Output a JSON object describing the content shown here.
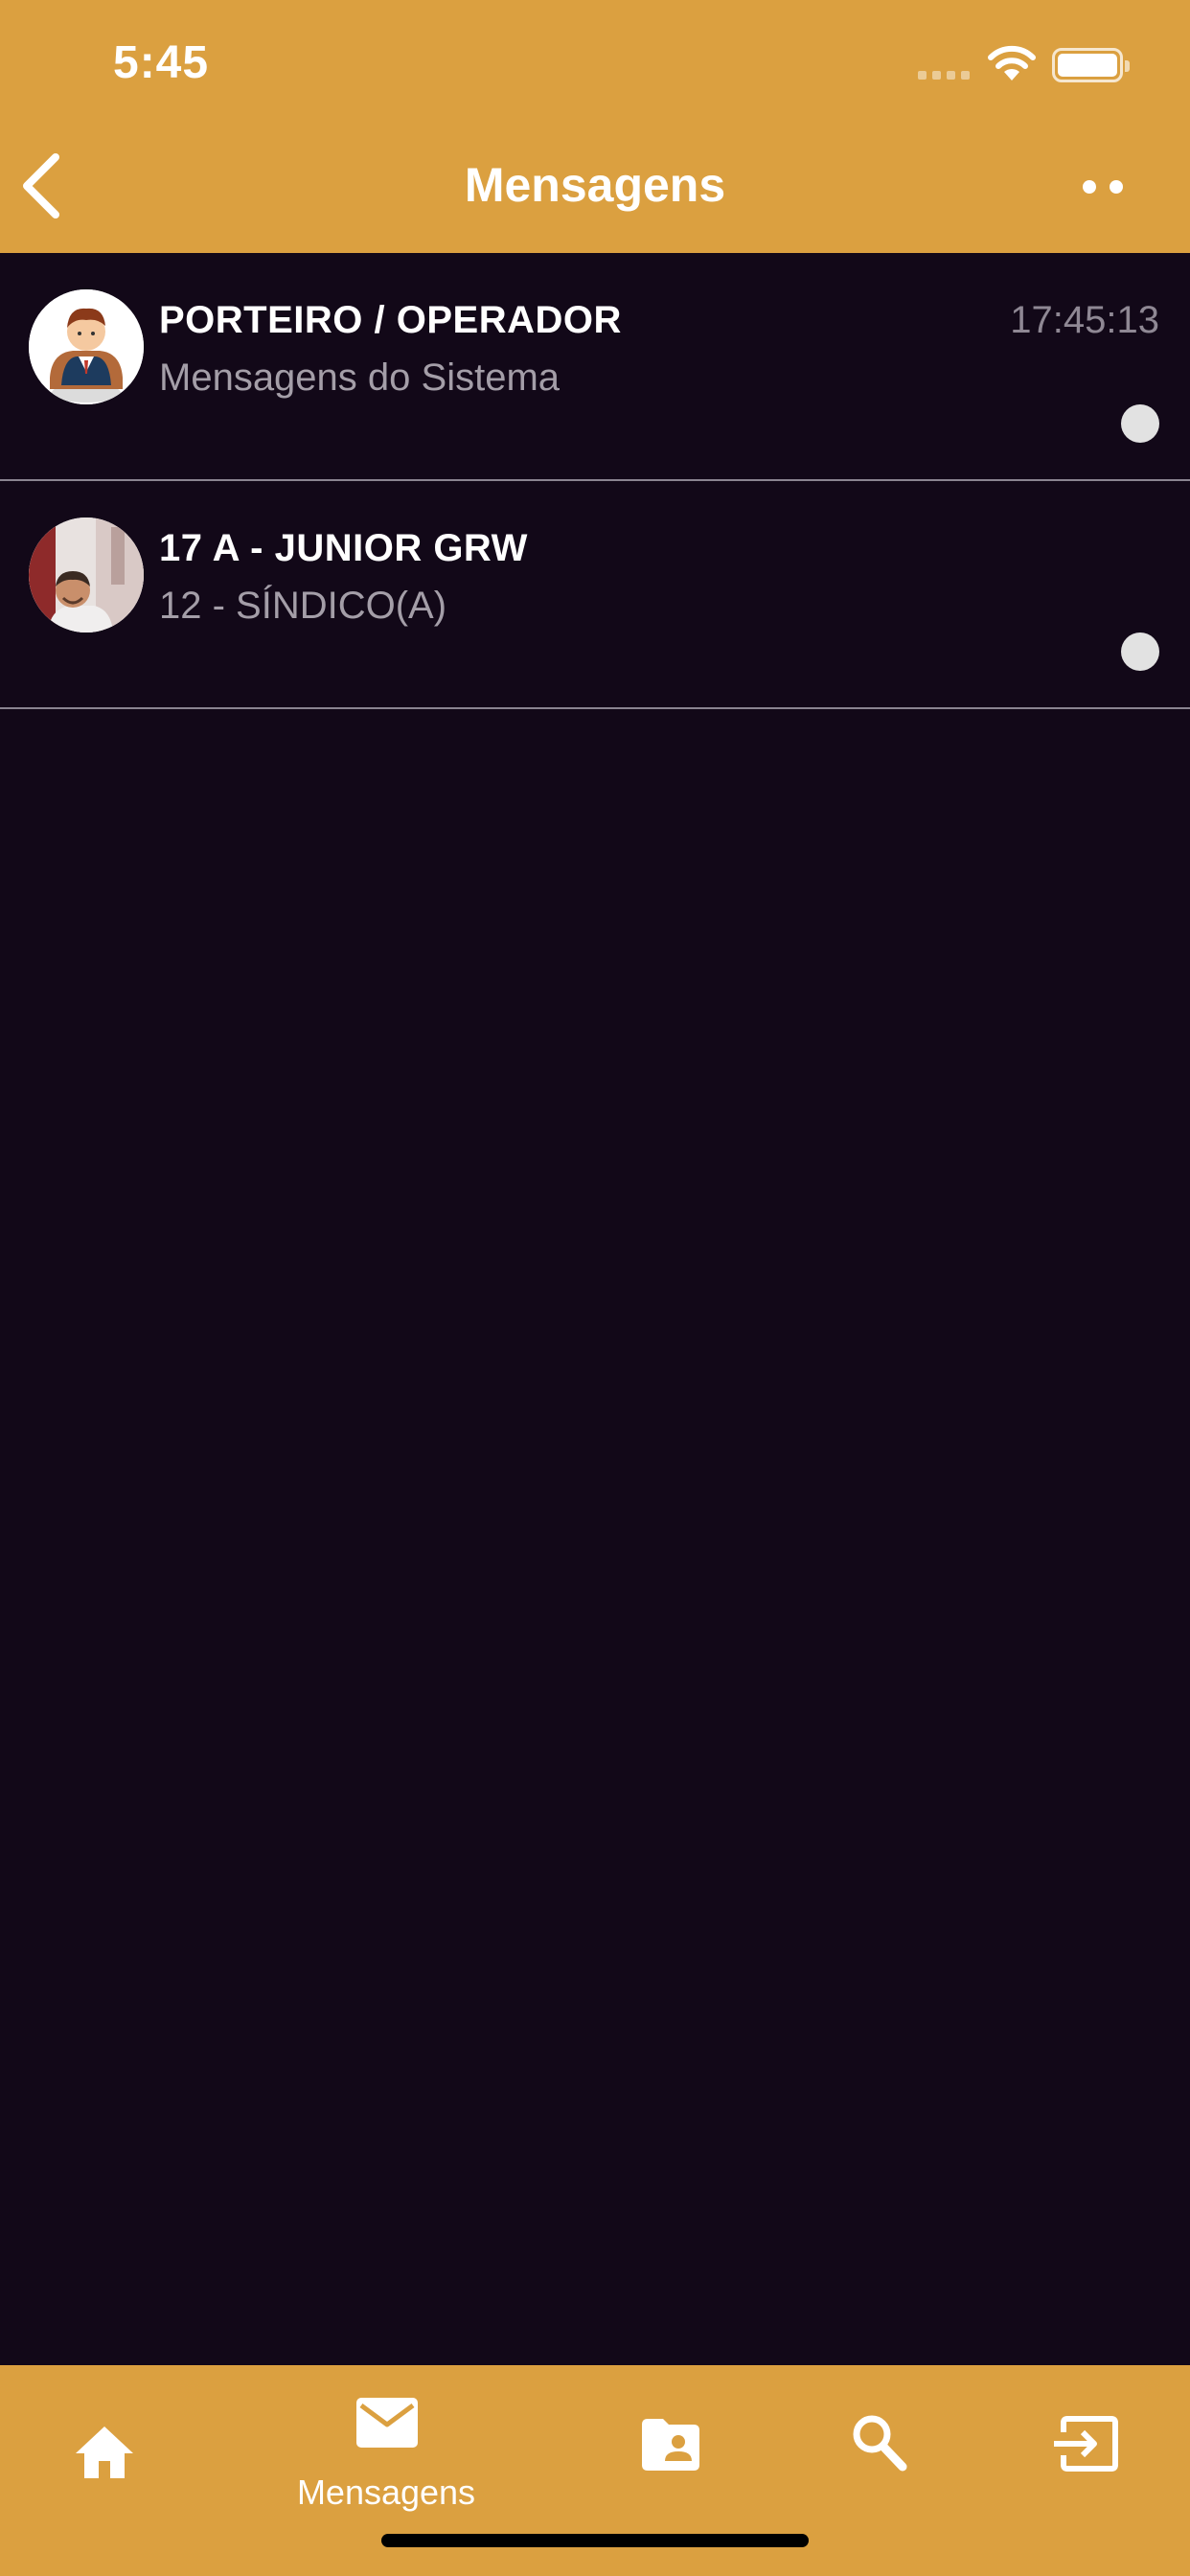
{
  "status_bar": {
    "time": "5:45"
  },
  "nav": {
    "title": "Mensagens"
  },
  "messages": [
    {
      "name": "PORTEIRO / OPERADOR",
      "subtitle": "Mensagens do Sistema",
      "time": "17:45:13",
      "avatar": "doorman-cartoon-avatar",
      "unread": true
    },
    {
      "name": "17 A - JUNIOR GRW",
      "subtitle": "12 - SÍNDICO(A)",
      "time": "",
      "avatar": "user-photo-avatar",
      "unread": true
    }
  ],
  "tabbar": {
    "items": [
      {
        "icon": "home-icon",
        "label": ""
      },
      {
        "icon": "mail-icon",
        "label": "Mensagens"
      },
      {
        "icon": "contact-folder-icon",
        "label": ""
      },
      {
        "icon": "search-icon",
        "label": ""
      },
      {
        "icon": "exit-icon",
        "label": ""
      }
    ],
    "active": "Mensagens"
  },
  "colors": {
    "brand": "#DBA040",
    "background": "#120818",
    "divider": "#8a8490",
    "subtitle": "#a49ea8"
  }
}
